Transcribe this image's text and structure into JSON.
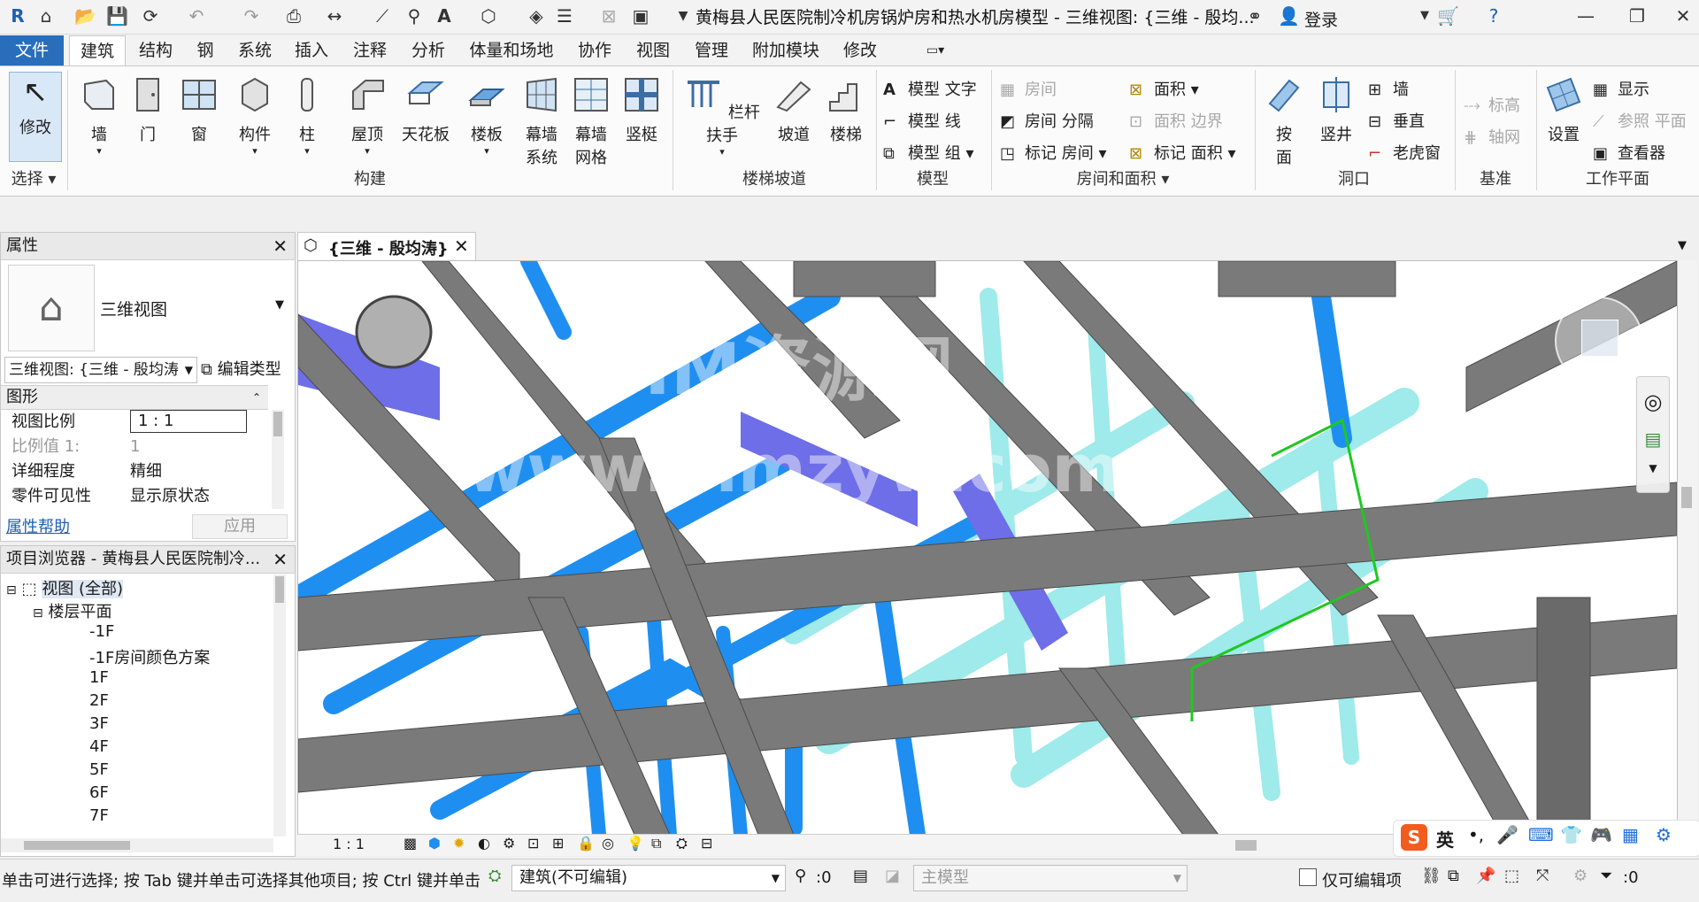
{
  "app": {
    "title": "黄梅县人民医院制冷机房锅炉房和热水机房模型 - 三维视图: {三维 - 殷均...",
    "login": "登录",
    "logo": "R"
  },
  "tabs": [
    "文件",
    "建筑",
    "结构",
    "钢",
    "系统",
    "插入",
    "注释",
    "分析",
    "体量和场地",
    "协作",
    "视图",
    "管理",
    "附加模块",
    "修改"
  ],
  "ribbon": {
    "modify": "修改",
    "select": "选择",
    "build": [
      "墙",
      "门",
      "窗",
      "构件",
      "柱",
      "屋顶",
      "天花板",
      "楼板"
    ],
    "curtain_system": [
      "幕墙",
      "系统"
    ],
    "curtain_grid": [
      "幕墙",
      "网格"
    ],
    "mullion": "竖梃",
    "build_panel": "构建",
    "railing": "栏杆扶手",
    "ramp": "坡道",
    "stair": "楼梯",
    "stair_panel": "楼梯坡道",
    "model_text": "模型 文字",
    "model_line": "模型 线",
    "model_group": "模型 组",
    "model_panel": "模型",
    "room": "房间",
    "room_sep": "房间 分隔",
    "tag_room": "标记 房间",
    "area": "面积",
    "area_boundary": "面积 边界",
    "tag_area": "标记 面积",
    "room_panel": "房间和面积",
    "by_face": [
      "按",
      "面"
    ],
    "shaft": "竖井",
    "wall_open": "墙",
    "vertical": "垂直",
    "dormer": "老虎窗",
    "opening_panel": "洞口",
    "level": "标高",
    "grid": "轴网",
    "datum_panel": "基准",
    "set": "设置",
    "show": "显示",
    "ref_plane": "参照 平面",
    "viewer": "查看器",
    "workplane_panel": "工作平面"
  },
  "properties": {
    "header": "属性",
    "type": "三维视图",
    "selector": "三维视图: {三维 - 殷均涛",
    "edit_type": "编辑类型",
    "group": "图形",
    "rows": [
      {
        "k": "视图比例",
        "v": "1 : 1"
      },
      {
        "k": "比例值 1:",
        "v": "1"
      },
      {
        "k": "详细程度",
        "v": "精细"
      },
      {
        "k": "零件可见性",
        "v": "显示原状态"
      }
    ],
    "help": "属性帮助",
    "apply": "应用"
  },
  "browser": {
    "header": "项目浏览器 - 黄梅县人民医院制冷...",
    "root": "视图 (全部)",
    "floor": "楼层平面",
    "items": [
      "-1F",
      "-1F房间颜色方案",
      "1F",
      "2F",
      "3F",
      "4F",
      "5F",
      "6F",
      "7F"
    ]
  },
  "view": {
    "tab": "{三维 - 殷均涛}",
    "scale": "1 : 1",
    "watermark1": "BIM资源网",
    "watermark2": "www.bimzyw.com"
  },
  "status": {
    "hint": "单击可进行选择; 按 Tab 键并单击可选择其他项目; 按 Ctrl 键并单击可",
    "workset": "建筑(不可编辑)",
    "count": ":0",
    "model": "主模型",
    "editable_only": "仅可编辑项",
    "filter": ":0",
    "ime": "英"
  }
}
